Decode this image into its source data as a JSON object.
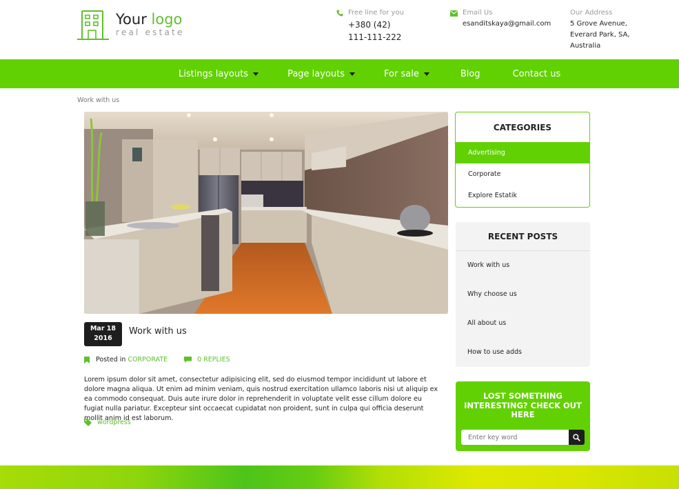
{
  "brand": {
    "title_part1": "Your",
    "title_part2": "logo",
    "subtitle": "real estate",
    "accent_color": "#62d104"
  },
  "contacts": {
    "phone": {
      "label": "Free line for you",
      "line1": "+380 (42)",
      "line2": "111-111-222",
      "icon": "phone-icon"
    },
    "email": {
      "label": "Email Us",
      "value": "esanditskaya@gmail.com",
      "icon": "envelope-icon"
    },
    "address": {
      "label": "Our Address",
      "line1": "5 Grove Avenue,",
      "line2": "Everard Park, SA,",
      "line3": "Australia"
    }
  },
  "nav": {
    "items": [
      {
        "label": "Listings layouts",
        "dropdown": true
      },
      {
        "label": "Page layouts",
        "dropdown": true
      },
      {
        "label": "For sale",
        "dropdown": true
      },
      {
        "label": "Blog",
        "dropdown": false
      },
      {
        "label": "Contact us",
        "dropdown": false
      }
    ]
  },
  "breadcrumb": "Work with us",
  "post": {
    "image_alt": "Modern kitchen interior",
    "date_line1": "Mar 18",
    "date_line2": "2016",
    "title": "Work with us",
    "posted_in_label": "Posted in",
    "category": "CORPORATE",
    "replies": "0 REPLIES",
    "body": "Lorem ipsum dolor sit amet, consectetur adipisicing elit, sed do eiusmod tempor incididunt ut labore et dolore magna aliqua. Ut enim ad minim veniam, quis nostrud exercitation ullamco laboris nisi ut aliquip ex ea commodo consequat. Duis aute irure dolor in reprehenderit in voluptate velit esse cillum dolore eu fugiat nulla pariatur. Excepteur sint occaecat cupidatat non proident, sunt in culpa qui officia deserunt mollit anim id est laborum.",
    "tag": "wordpress"
  },
  "sidebar": {
    "categories": {
      "title": "CATEGORIES",
      "items": [
        {
          "label": "Advertising",
          "active": true
        },
        {
          "label": "Corporate",
          "active": false
        },
        {
          "label": "Explore Estatik",
          "active": false
        }
      ]
    },
    "recent_posts": {
      "title": "RECENT POSTS",
      "items": [
        "Work with us",
        "Why choose us",
        "All about us",
        "How to use adds"
      ]
    },
    "search": {
      "title": "LOST SOMETHING INTERESTING? CHECK OUT HERE",
      "placeholder": "Enter key word",
      "value": ""
    }
  }
}
